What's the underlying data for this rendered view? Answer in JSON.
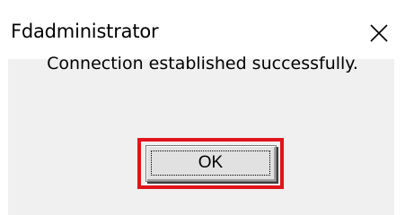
{
  "window": {
    "title": "Fdadministrator",
    "close_icon": "close-icon"
  },
  "dialog": {
    "message": "Connection established successfully.",
    "ok_label": "OK",
    "highlight_color": "#e0141c",
    "background": "#f0f0f0"
  }
}
